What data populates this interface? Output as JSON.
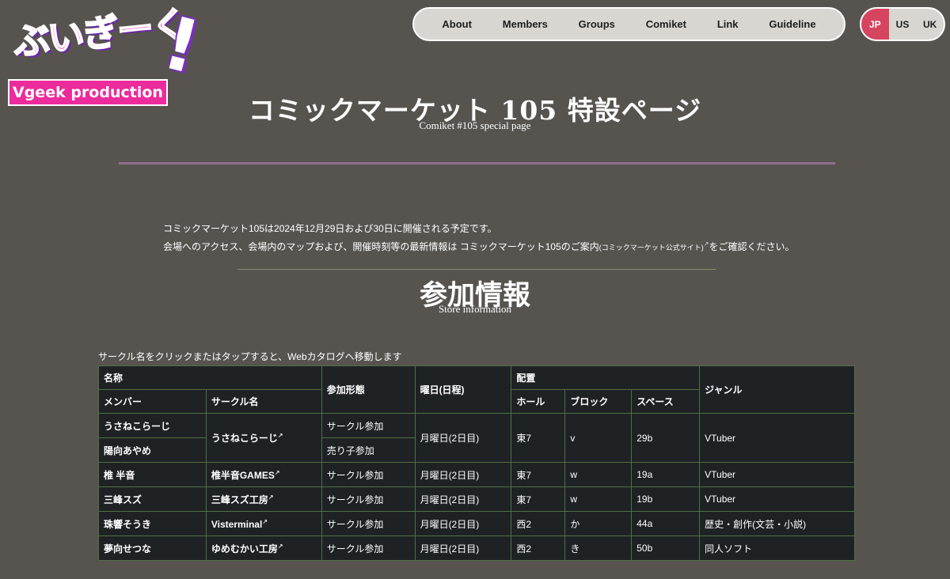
{
  "logo": {
    "script_text": "ぶいぎーく",
    "band_text": "Vgeek production"
  },
  "nav": {
    "items": [
      "About",
      "Members",
      "Groups",
      "Comiket",
      "Link",
      "Guideline"
    ]
  },
  "lang": {
    "items": [
      "JP",
      "US",
      "UK"
    ],
    "active": "JP"
  },
  "title": {
    "main": "コミックマーケット 105 特設ページ",
    "sub": "Comiket #105 special page"
  },
  "intro": {
    "line1": "コミックマーケット105は2024年12月29日および30日に開催される予定です。",
    "line2_prefix": "会場へのアクセス、会場内のマップおよび、開催時刻等の最新情報は ",
    "line2_link": "コミックマーケット105のご案内",
    "line2_small": "(コミックマーケット公式サイト)",
    "line2_suffix": "をご確認ください。"
  },
  "section": {
    "title": "参加情報",
    "sub": "Store information"
  },
  "table_note": "サークル名をクリックまたはタップすると、Webカタログへ移動します",
  "table": {
    "headers": {
      "name": "名称",
      "member": "メンバー",
      "circle": "サークル名",
      "participation": "参加形態",
      "day": "曜日(日程)",
      "placement": "配置",
      "hall": "ホール",
      "block": "ブロック",
      "space": "スペース",
      "genre": "ジャンル"
    },
    "rows": [
      {
        "member": "うさねこらーじ",
        "circle": "うさねこらーじ",
        "participation": "サークル参加",
        "day": "月曜日(2日目)",
        "hall": "東7",
        "block": "v",
        "space": "29b",
        "genre": "VTuber"
      },
      {
        "member": "陽向あやめ",
        "participation": "売り子参加"
      },
      {
        "member": "椎 半音",
        "circle": "椎半音GAMES",
        "participation": "サークル参加",
        "day": "月曜日(2日目)",
        "hall": "東7",
        "block": "w",
        "space": "19a",
        "genre": "VTuber"
      },
      {
        "member": "三峰スズ",
        "circle": "三峰スズ工房",
        "participation": "サークル参加",
        "day": "月曜日(2日目)",
        "hall": "東7",
        "block": "w",
        "space": "19b",
        "genre": "VTuber"
      },
      {
        "member": "珠響そうき",
        "circle": "Visterminal",
        "participation": "サークル参加",
        "day": "月曜日(2日目)",
        "hall": "西2",
        "block": "か",
        "space": "44a",
        "genre": "歴史・創作(文芸・小説)"
      },
      {
        "member": "夢向せつな",
        "circle": "ゆめむかい工房",
        "participation": "サークル参加",
        "day": "月曜日(2日目)",
        "hall": "西2",
        "block": "き",
        "space": "50b",
        "genre": "同人ソフト"
      }
    ]
  },
  "colors": {
    "background": "#575450",
    "accent_pink": "#ec2b9c",
    "lang_active": "#d6455f",
    "table_bg": "#1f2225",
    "table_border": "#4f6f43"
  }
}
